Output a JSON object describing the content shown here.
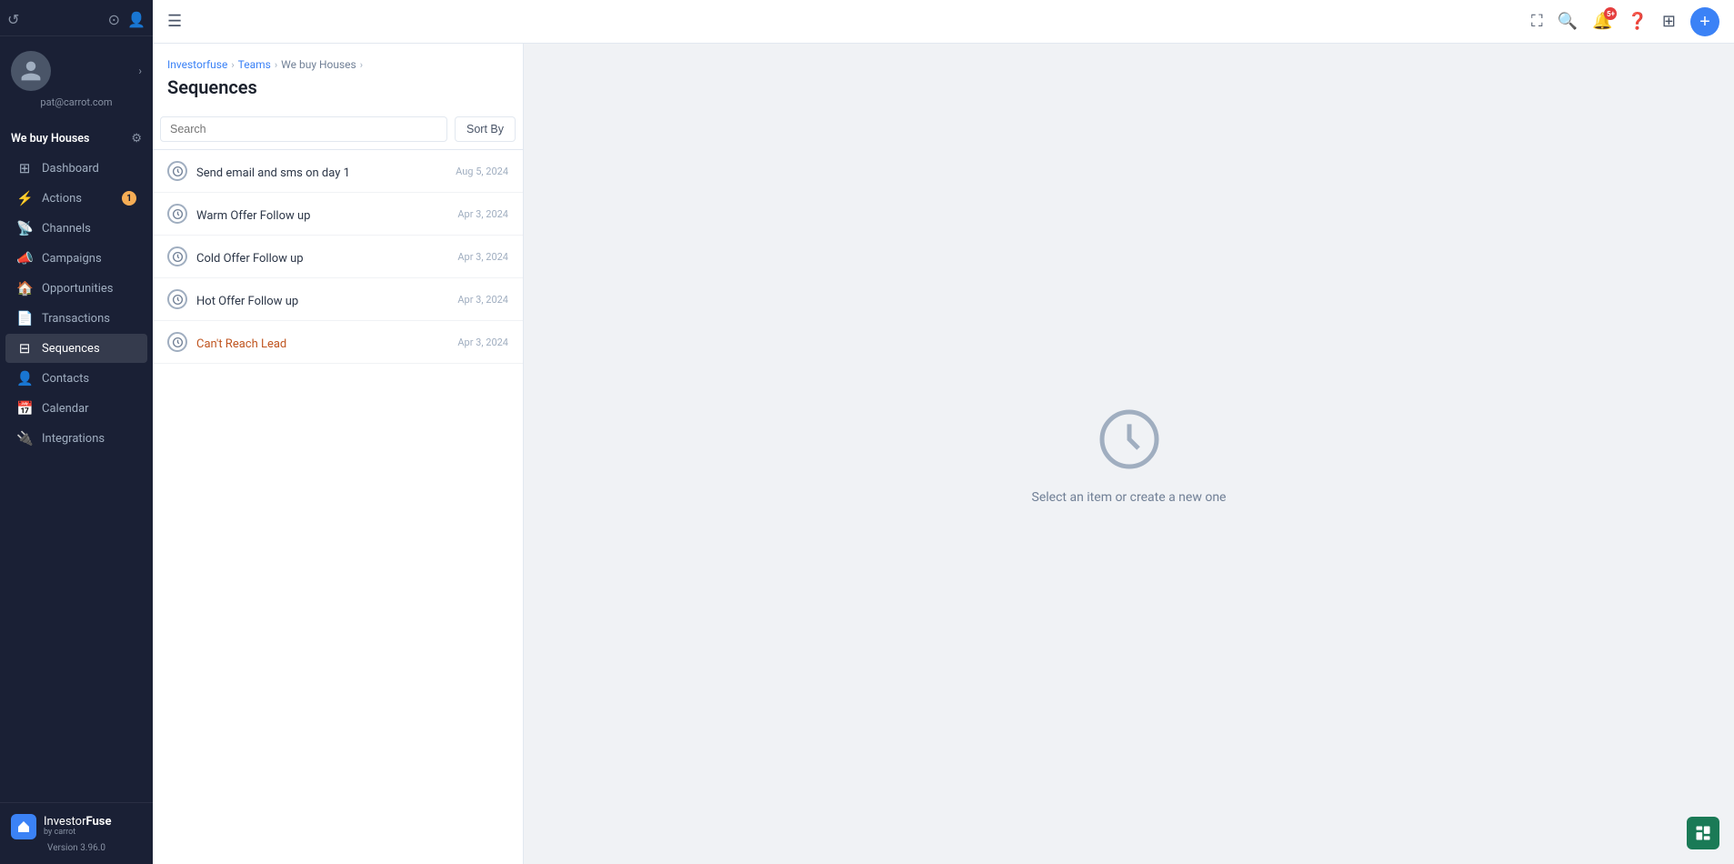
{
  "sidebar": {
    "user_email": "pat@carrot.com",
    "workspace_name": "We buy Houses",
    "nav_items": [
      {
        "id": "dashboard",
        "label": "Dashboard",
        "icon": "grid"
      },
      {
        "id": "actions",
        "label": "Actions",
        "icon": "lightning",
        "badge": "1"
      },
      {
        "id": "channels",
        "label": "Channels",
        "icon": "wifi"
      },
      {
        "id": "campaigns",
        "label": "Campaigns",
        "icon": "volume"
      },
      {
        "id": "opportunities",
        "label": "Opportunities",
        "icon": "home"
      },
      {
        "id": "transactions",
        "label": "Transactions",
        "icon": "file"
      },
      {
        "id": "sequences",
        "label": "Sequences",
        "icon": "table",
        "active": true
      },
      {
        "id": "contacts",
        "label": "Contacts",
        "icon": "person"
      },
      {
        "id": "calendar",
        "label": "Calendar",
        "icon": "calendar"
      },
      {
        "id": "integrations",
        "label": "Integrations",
        "icon": "plug"
      }
    ],
    "brand": {
      "name_top": "InvestorFuse",
      "name_sub": "by carrot",
      "version": "Version 3.96.0"
    }
  },
  "topbar": {
    "notification_count": "5+"
  },
  "breadcrumb": {
    "items": [
      "Investorfuse",
      "Teams",
      "We buy Houses"
    ],
    "links": [
      true,
      true,
      true
    ]
  },
  "page_title": "Sequences",
  "search": {
    "placeholder": "Search"
  },
  "sort_btn_label": "Sort By",
  "sequences": [
    {
      "name": "Send email and sms on day 1",
      "date": "Aug 5, 2024",
      "link_style": false
    },
    {
      "name": "Warm Offer Follow up",
      "date": "Apr 3, 2024",
      "link_style": false
    },
    {
      "name": "Cold Offer Follow up",
      "date": "Apr 3, 2024",
      "link_style": false
    },
    {
      "name": "Hot Offer Follow up",
      "date": "Apr 3, 2024",
      "link_style": false
    },
    {
      "name": "Can't Reach Lead",
      "date": "Apr 3, 2024",
      "link_style": true
    }
  ],
  "empty_state": {
    "text": "Select an item or create a new one"
  },
  "add_btn_label": "+"
}
